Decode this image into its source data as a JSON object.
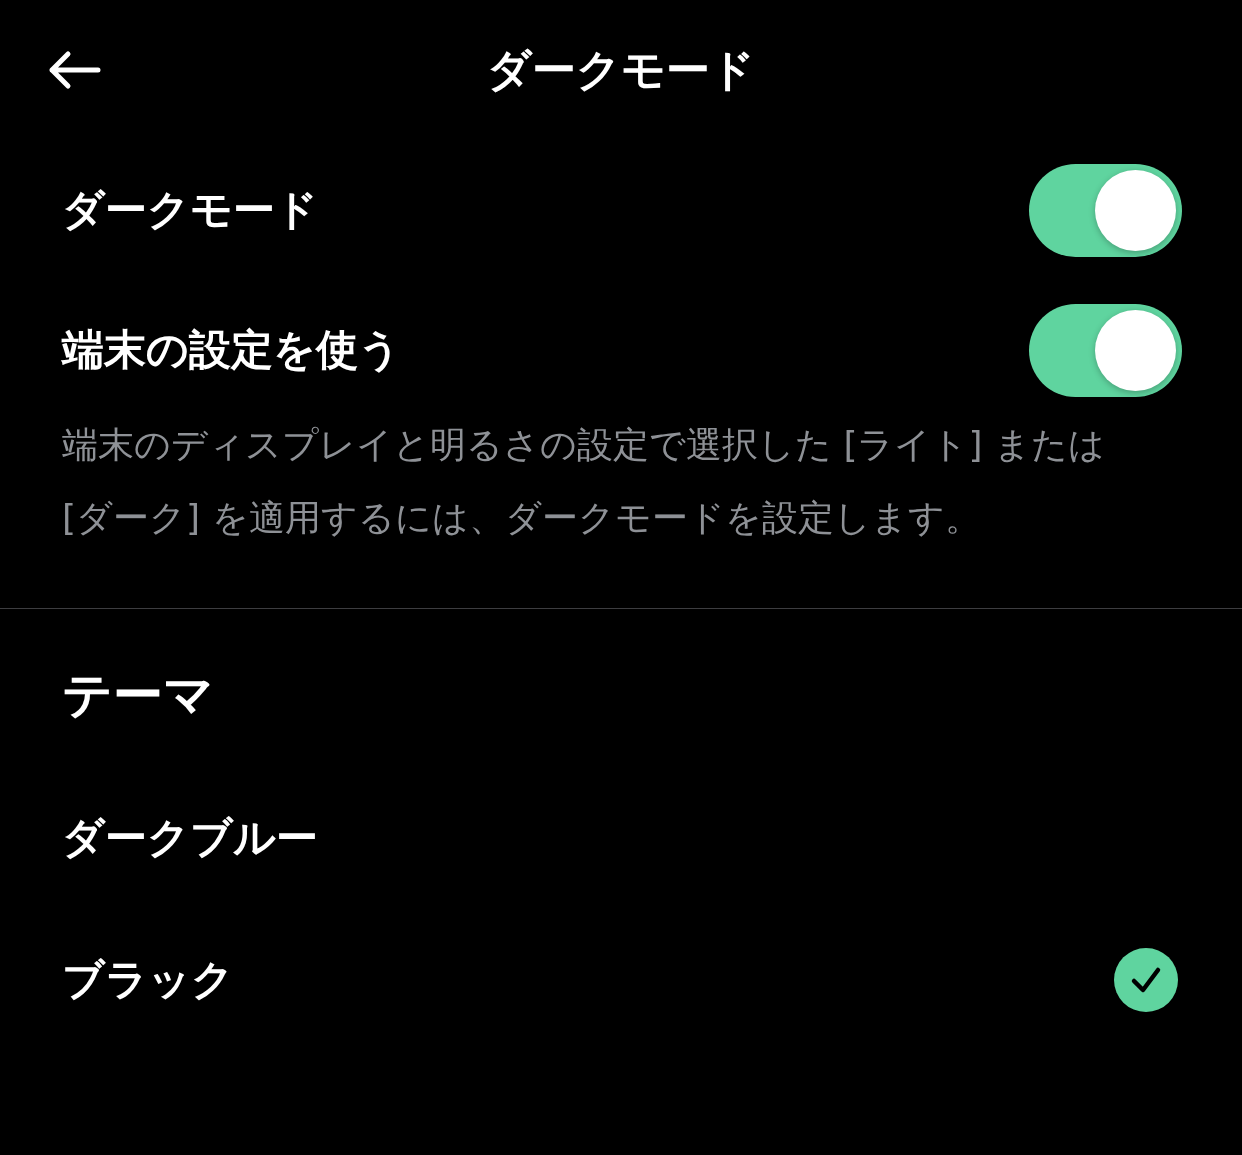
{
  "header": {
    "title": "ダークモード"
  },
  "settings": [
    {
      "label": "ダークモード",
      "on": true
    },
    {
      "label": "端末の設定を使う",
      "on": true
    }
  ],
  "description": "端末のディスプレイと明るさの設定で選択した [ライト] または [ダーク] を適用するには、ダークモードを設定します。",
  "theme": {
    "heading": "テーマ",
    "options": [
      {
        "label": "ダークブルー",
        "selected": false
      },
      {
        "label": "ブラック",
        "selected": true
      }
    ]
  }
}
